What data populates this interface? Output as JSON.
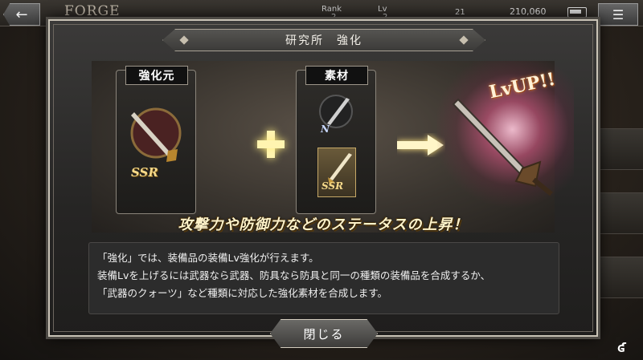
{
  "header": {
    "back_icon": "back-arrow-icon",
    "title": "FORGE",
    "rank_label": "Rank",
    "rank_value": "2",
    "lv_label": "Lv",
    "lv_value": "2",
    "currency_small": "21",
    "money": "210,060",
    "menu_icon": "hamburger-icon"
  },
  "modal": {
    "title": "研究所　強化",
    "base_label": "強化元",
    "material_label": "素材",
    "base_rarity": "SSR",
    "material_rarity_1": "N",
    "material_rarity_2": "SSR",
    "lvup_text": "LvUP!!",
    "catchphrase": "攻撃力や防御力などのステータスの上昇！",
    "description": [
      "「強化」では、装備品の装備Lv強化が行えます。",
      "装備Lvを上げるには武器なら武器、防具なら防具と同一の種類の装備品を合成するか、",
      "「武器のクォーツ」など種類に対応した強化素材を合成します。"
    ],
    "close_label": "閉じる"
  },
  "colors": {
    "accent_gold": "#fff3c9",
    "frame": "#c9c3b6",
    "burst_pink": "#e65a8c"
  }
}
